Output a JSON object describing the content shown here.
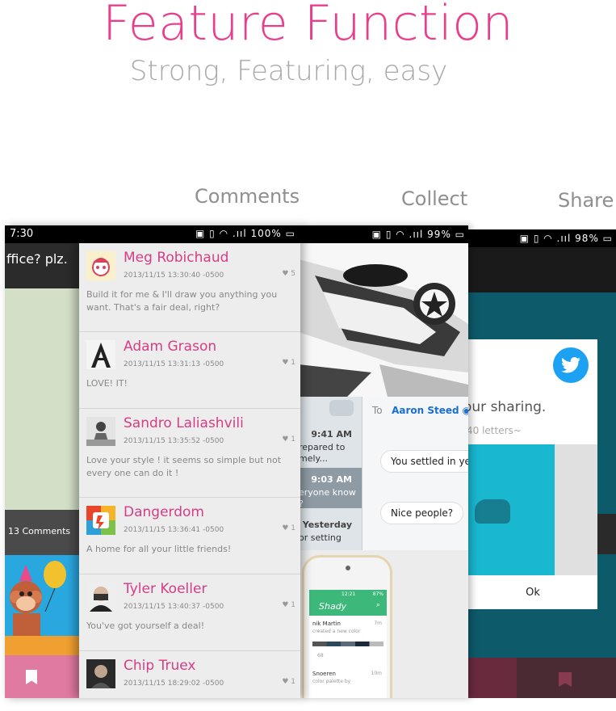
{
  "hero": {
    "title": "Feature Function",
    "subtitle": "Strong, Featuring, easy"
  },
  "sections": {
    "comments": "Comments",
    "collect": "Collect",
    "share": "Share"
  },
  "phone1": {
    "status_time": "7:30",
    "status_battery": "100%",
    "sidebar_title": "ffice? plz.",
    "comments_count": "13 Comments",
    "comments": [
      {
        "name": "Meg Robichaud",
        "date": "2013/11/15 13:30:40 -0500",
        "likes": "5",
        "body": "Build it for me & I'll draw you anything you want. That's a fair deal, right?"
      },
      {
        "name": "Adam Grason",
        "date": "2013/11/15 13:31:13 -0500",
        "likes": "1",
        "body": "LOVE! IT!"
      },
      {
        "name": "Sandro Laliashvili",
        "date": "2013/11/15 13:35:52 -0500",
        "likes": "1",
        "body": "Love your style ! it seems so simple but not every one can do it !"
      },
      {
        "name": "Dangerdom",
        "date": "2013/11/15 13:36:41 -0500",
        "likes": "1",
        "body": "A home for all your little friends!"
      },
      {
        "name": "Tyler Koeller",
        "date": "2013/11/15 13:40:37 -0500",
        "likes": "1",
        "body": "You've got yourself a deal!"
      },
      {
        "name": "Chip Truex",
        "date": "2013/11/15 18:29:02 -0500",
        "likes": "1",
        "body": ""
      }
    ]
  },
  "phone2": {
    "status_battery": "99%",
    "to_label": "To",
    "recipient": "Aaron Steed",
    "messages": [
      {
        "time": "9:41 AM",
        "text_1": "repared to",
        "text_2": "mely..."
      },
      {
        "time": "9:03 AM",
        "text_1": "eryone know",
        "text_2": "?"
      },
      {
        "time": "Yesterday",
        "text_1": "or setting",
        "text_2": ""
      }
    ],
    "bubbles": [
      "You settled in ye",
      "Nice people?"
    ],
    "app_name": "Shady",
    "app_status_time": "12:21",
    "app_status_battery": "87%",
    "app_user": "nik Martin",
    "app_user_action": "created a new color",
    "app_user_time": "7m",
    "app_likes": "68",
    "app_user2": "Snoeren",
    "app_user2_action": "color palette by",
    "app_user2_time": "10m"
  },
  "phone3": {
    "status_battery": "98%",
    "dialog_title": "our sharing.",
    "dialog_hint": "40 letters~",
    "ok_label": "Ok"
  },
  "colors": {
    "accent_pink": "#e83e8c",
    "name_pink": "#d63d85",
    "twitter_blue": "#1da1f2",
    "teal": "#0d5a6a"
  }
}
